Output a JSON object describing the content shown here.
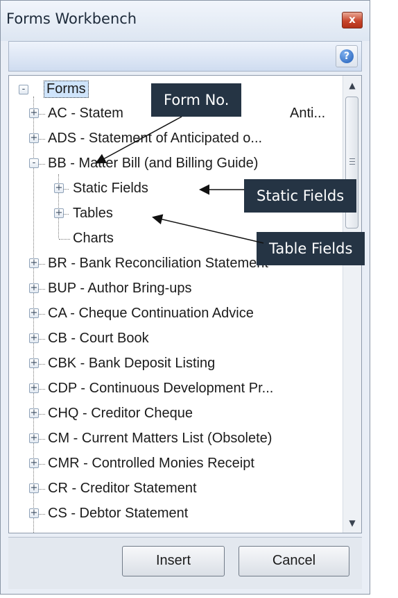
{
  "window": {
    "title": "Forms Workbench",
    "close_glyph": "x"
  },
  "toolbar": {
    "help_glyph": "?",
    "help_icon": "help-icon"
  },
  "tree": {
    "root": "Forms",
    "items": [
      {
        "label": "AC - Statem",
        "label_tail": "Anti...",
        "expander": "+"
      },
      {
        "label": "ADS - Statement of Anticipated o...",
        "expander": "+"
      },
      {
        "label": "BB - Matter Bill (and Billing Guide)",
        "expander": "-"
      },
      {
        "label": "Static Fields",
        "expander": "+",
        "child": true
      },
      {
        "label": "Tables",
        "expander": "+",
        "child": true
      },
      {
        "label": "Charts",
        "expander": "",
        "child": true
      },
      {
        "label": "BR - Bank Reconciliation Statement",
        "expander": "+"
      },
      {
        "label": "BUP - Author Bring-ups",
        "expander": "+"
      },
      {
        "label": "CA - Cheque Continuation Advice",
        "expander": "+"
      },
      {
        "label": "CB - Court Book",
        "expander": "+"
      },
      {
        "label": "CBK - Bank Deposit Listing",
        "expander": "+"
      },
      {
        "label": "CDP - Continuous Development Pr...",
        "expander": "+"
      },
      {
        "label": "CHQ - Creditor Cheque",
        "expander": "+"
      },
      {
        "label": "CM - Current Matters List (Obsolete)",
        "expander": "+"
      },
      {
        "label": "CMR - Controlled Monies Receipt",
        "expander": "+"
      },
      {
        "label": "CR - Creditor Statement",
        "expander": "+"
      },
      {
        "label": "CS - Debtor Statement",
        "expander": "+"
      }
    ],
    "root_expander": "-"
  },
  "buttons": {
    "insert": "Insert",
    "cancel": "Cancel"
  },
  "annotations": {
    "form_no": "Form No.",
    "static_fields": "Static Fields",
    "table_fields": "Table Fields"
  },
  "scrollbar": {
    "up": "▲",
    "down": "▼"
  },
  "colors": {
    "callout_bg": "#253444",
    "selection_bg": "#cfe4fb",
    "close_red": "#c8462d"
  }
}
